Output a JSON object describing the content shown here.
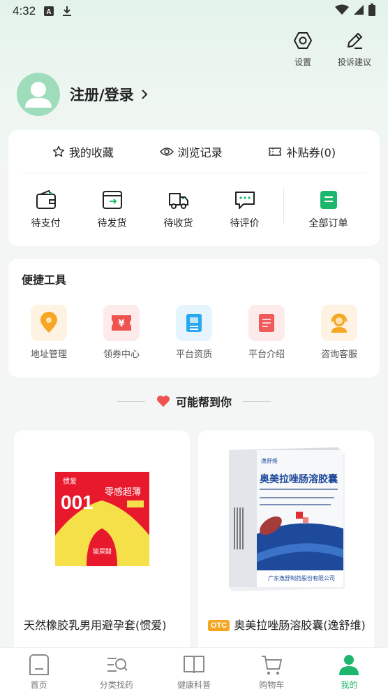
{
  "status": {
    "time": "4:32"
  },
  "top_actions": {
    "settings": "设置",
    "feedback": "投诉建议"
  },
  "profile": {
    "login_label": "注册/登录"
  },
  "quick_links": [
    {
      "label": "我的收藏",
      "icon": "star-icon"
    },
    {
      "label": "浏览记录",
      "icon": "eye-icon"
    },
    {
      "label": "补贴券(0)",
      "icon": "ticket-icon"
    }
  ],
  "orders": [
    {
      "label": "待支付",
      "icon": "wallet-icon"
    },
    {
      "label": "待发货",
      "icon": "package-send-icon"
    },
    {
      "label": "待收货",
      "icon": "truck-icon"
    },
    {
      "label": "待评价",
      "icon": "comment-icon"
    },
    {
      "label": "全部订单",
      "icon": "orders-icon"
    }
  ],
  "tools": {
    "title": "便捷工具",
    "items": [
      {
        "label": "地址管理",
        "icon": "location-icon",
        "color": "#f5a623"
      },
      {
        "label": "领券中心",
        "icon": "coupon-icon",
        "color": "#ef5350"
      },
      {
        "label": "平台资质",
        "icon": "certificate-icon",
        "color": "#2aa8f2"
      },
      {
        "label": "平台介绍",
        "icon": "document-icon",
        "color": "#ef5a5a"
      },
      {
        "label": "咨询客服",
        "icon": "customer-service-icon",
        "color": "#f5a623"
      }
    ]
  },
  "recommend": {
    "title": "可能帮到你"
  },
  "products": [
    {
      "name": "天然橡胶乳男用避孕套(惯爱)",
      "otc": "",
      "box_text": {
        "brand": "惯爱",
        "number": "001",
        "slogan": "零感超薄",
        "sub": "玻尿酸"
      }
    },
    {
      "name": "奥美拉唑肠溶胶囊(逸舒维)",
      "otc": "OTC",
      "box_text": {
        "title": "奥美拉唑肠溶胶囊",
        "brand": "逸舒维",
        "maker": "广东逸舒制药股份有限公司"
      }
    }
  ],
  "tabbar": [
    {
      "label": "首页",
      "icon": "home-icon",
      "active": false
    },
    {
      "label": "分类找药",
      "icon": "category-search-icon",
      "active": false
    },
    {
      "label": "健康科普",
      "icon": "book-icon",
      "active": false
    },
    {
      "label": "购物车",
      "icon": "cart-icon",
      "active": false
    },
    {
      "label": "我的",
      "icon": "user-icon",
      "active": true
    }
  ],
  "colors": {
    "accent": "#1db66d",
    "avatar_bg": "#9fdcbc"
  }
}
